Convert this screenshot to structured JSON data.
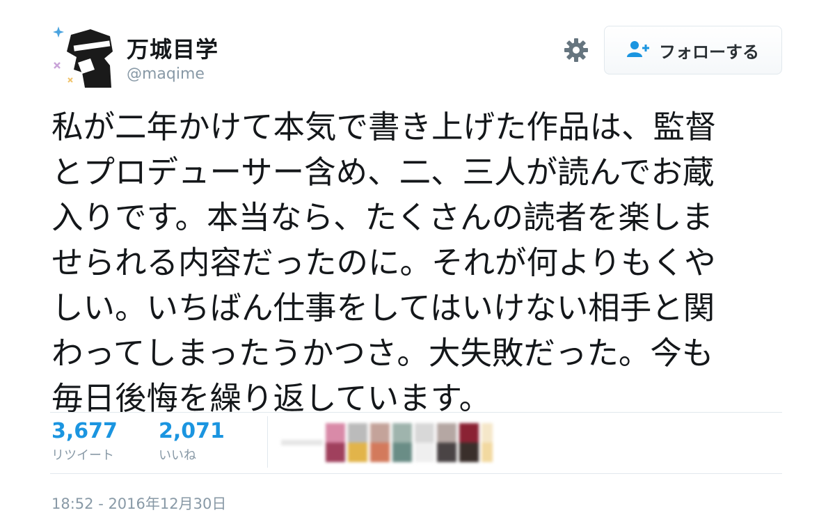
{
  "user": {
    "display_name": "万城目学",
    "screen_name": "@maqime"
  },
  "actions": {
    "follow_label": "フォローする",
    "follow_icon": "add-user-icon",
    "settings_icon": "gear-icon"
  },
  "tweet": {
    "lines": [
      "私が二年かけて本気で書き上げた作品は、監督",
      "とプロデューサー含め、二、三人が読んでお蔵",
      "入りです。本当なら、たくさんの読者を楽しま",
      "せられる内容だったのに。それが何よりもくや",
      "しい。いちばん仕事をしてはいけない相手と関",
      "わってしまったうかつさ。大失敗だった。今も",
      "毎日後悔を繰り返しています。"
    ]
  },
  "stats": {
    "retweets": {
      "count": "3,677",
      "label": "リツイート"
    },
    "likes": {
      "count": "2,071",
      "label": "いいね"
    }
  },
  "likers_note": "pixelated avatar thumbnails",
  "timestamp": "18:52 - 2016年12月30日",
  "colors": {
    "accent": "#1b95e0",
    "muted": "#8899a6",
    "border": "#e1e8ed",
    "text": "#14171a"
  }
}
